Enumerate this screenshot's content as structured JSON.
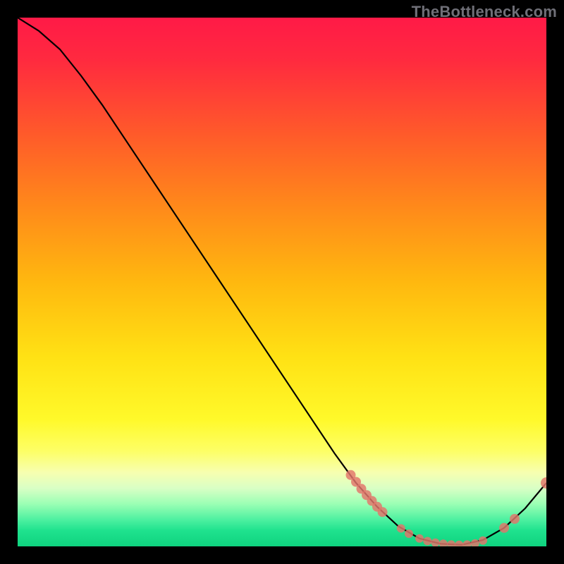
{
  "watermark": "TheBottleneck.com",
  "colors": {
    "point": "#e2766b",
    "line": "#000000",
    "background_top": "#ff1a47",
    "background_bottom": "#0fd37f",
    "frame": "#000000"
  },
  "chart_data": {
    "type": "line",
    "title": "",
    "xlabel": "",
    "ylabel": "",
    "xlim": [
      0,
      100
    ],
    "ylim": [
      0,
      100
    ],
    "grid": false,
    "annotations": [
      "TheBottleneck.com"
    ],
    "series": [
      {
        "name": "curve",
        "x": [
          0,
          4,
          8,
          12,
          16,
          20,
          24,
          28,
          32,
          36,
          40,
          44,
          48,
          52,
          56,
          60,
          64,
          68,
          72,
          76,
          80,
          84,
          88,
          92,
          96,
          100
        ],
        "y": [
          100,
          97.5,
          94,
          89,
          83.5,
          77.5,
          71.5,
          65.5,
          59.5,
          53.5,
          47.5,
          41.5,
          35.5,
          29.5,
          23.5,
          17.5,
          12,
          7.5,
          3.8,
          1.5,
          0.5,
          0.3,
          1.2,
          3.5,
          7.2,
          12
        ]
      }
    ],
    "points": [
      {
        "x": 63,
        "y": 13.5
      },
      {
        "x": 64,
        "y": 12.2
      },
      {
        "x": 65,
        "y": 10.9
      },
      {
        "x": 66,
        "y": 9.7
      },
      {
        "x": 67,
        "y": 8.6
      },
      {
        "x": 68,
        "y": 7.5
      },
      {
        "x": 69,
        "y": 6.5
      },
      {
        "x": 72.5,
        "y": 3.4
      },
      {
        "x": 74,
        "y": 2.4
      },
      {
        "x": 76,
        "y": 1.5
      },
      {
        "x": 77.5,
        "y": 1.0
      },
      {
        "x": 79,
        "y": 0.7
      },
      {
        "x": 80.5,
        "y": 0.5
      },
      {
        "x": 82,
        "y": 0.35
      },
      {
        "x": 83.5,
        "y": 0.3
      },
      {
        "x": 85,
        "y": 0.35
      },
      {
        "x": 86.5,
        "y": 0.55
      },
      {
        "x": 88,
        "y": 1.1
      },
      {
        "x": 92,
        "y": 3.5
      },
      {
        "x": 94,
        "y": 5.2
      },
      {
        "x": 100,
        "y": 12
      }
    ],
    "point_radii": [
      7,
      7,
      7,
      7,
      7,
      7,
      7,
      6,
      6,
      6,
      6,
      6,
      6,
      6,
      6,
      6,
      6,
      6,
      7,
      7,
      8
    ]
  }
}
